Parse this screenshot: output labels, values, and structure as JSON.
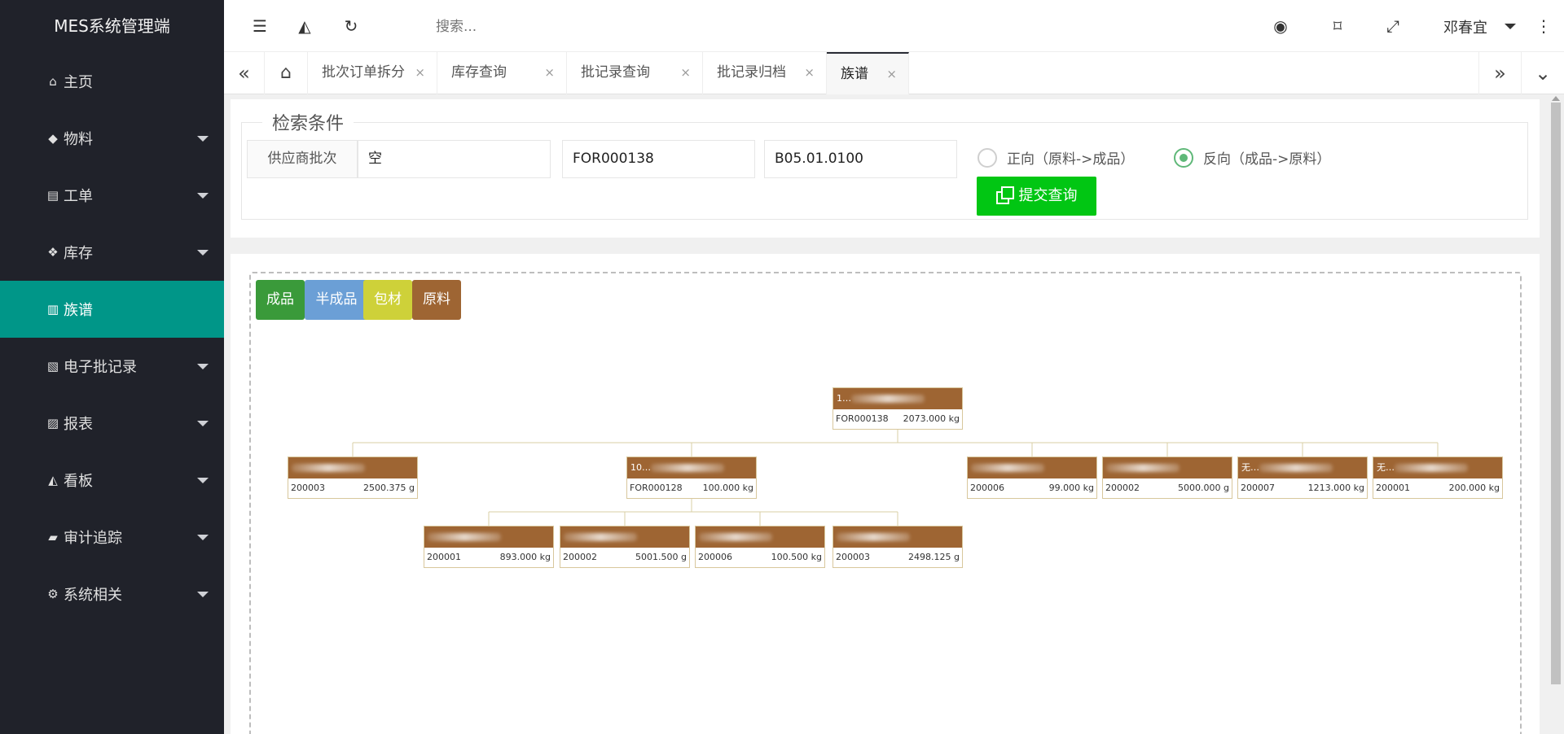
{
  "app": {
    "title": "MES系统管理端"
  },
  "sidebar": {
    "items": [
      {
        "label": "主页",
        "icon": "home-icon",
        "glyph": "⌂",
        "has_caret": false,
        "active": false
      },
      {
        "label": "物料",
        "icon": "cube-icon",
        "glyph": "◆",
        "has_caret": true,
        "active": false
      },
      {
        "label": "工单",
        "icon": "file-text-icon",
        "glyph": "▤",
        "has_caret": true,
        "active": false
      },
      {
        "label": "库存",
        "icon": "cubes-icon",
        "glyph": "❖",
        "has_caret": true,
        "active": false
      },
      {
        "label": "族谱",
        "icon": "file-archive-icon",
        "glyph": "▥",
        "has_caret": false,
        "active": true
      },
      {
        "label": "电子批记录",
        "icon": "file-pdf-icon",
        "glyph": "▧",
        "has_caret": true,
        "active": false
      },
      {
        "label": "报表",
        "icon": "file-excel-icon",
        "glyph": "▨",
        "has_caret": true,
        "active": false
      },
      {
        "label": "看板",
        "icon": "area-chart-icon",
        "glyph": "◭",
        "has_caret": true,
        "active": false
      },
      {
        "label": "审计追踪",
        "icon": "book-icon",
        "glyph": "▰",
        "has_caret": true,
        "active": false
      },
      {
        "label": "系统相关",
        "icon": "cogs-icon",
        "glyph": "⚙",
        "has_caret": true,
        "active": false
      }
    ]
  },
  "header": {
    "search_placeholder": "搜索...",
    "user_name": "邓春宜",
    "icons": {
      "menu_toggle": "☰",
      "chart": "◭",
      "refresh": "↻",
      "theme": "◉",
      "tag": "⌑",
      "fullscreen": "⤢",
      "more": "⋮"
    }
  },
  "tabs": {
    "nav_left": "«",
    "nav_right": "»",
    "dropdown": "⌄",
    "home": "⌂",
    "items": [
      {
        "label": "批次订单拆分",
        "close": "×"
      },
      {
        "label": "库存查询",
        "close": "×"
      },
      {
        "label": "批记录查询",
        "close": "×"
      },
      {
        "label": "批记录归档",
        "close": "×"
      },
      {
        "label": "族谱",
        "close": "×"
      }
    ]
  },
  "search_panel": {
    "legend": "检索条件",
    "supplier_batch_label": "供应商批次",
    "supplier_batch_value": "空",
    "material_code_value": "FOR000138",
    "batch_no_value": "B05.01.0100",
    "radio_forward": "正向（原料->成品）",
    "radio_reverse": "反向（成品->原料）",
    "selected": "reverse",
    "submit_label": "提交查询"
  },
  "legend_types": [
    {
      "label": "成品",
      "color": "#3a9a3a"
    },
    {
      "label": "半成品",
      "color": "#6b9fd6"
    },
    {
      "label": "包材",
      "color": "#ced139"
    },
    {
      "label": "原料",
      "color": "#9e6533"
    }
  ],
  "tree": {
    "root": {
      "name": "1…",
      "code": "FOR000138",
      "qty": "2073.000 kg"
    },
    "level1": [
      {
        "name": "",
        "code": "200003",
        "qty": "2500.375 g"
      },
      {
        "name": "10…",
        "code": "FOR000128",
        "qty": "100.000 kg"
      },
      {
        "name": "",
        "code": "200006",
        "qty": "99.000 kg"
      },
      {
        "name": "",
        "code": "200002",
        "qty": "5000.000 g"
      },
      {
        "name": "无…",
        "code": "200007",
        "qty": "1213.000 kg"
      },
      {
        "name": "无…",
        "code": "200001",
        "qty": "200.000 kg"
      }
    ],
    "level2": [
      {
        "name": "",
        "code": "200001",
        "qty": "893.000 kg"
      },
      {
        "name": "",
        "code": "200002",
        "qty": "5001.500 g"
      },
      {
        "name": "",
        "code": "200006",
        "qty": "100.500 kg"
      },
      {
        "name": "",
        "code": "200003",
        "qty": "2498.125 g"
      }
    ]
  }
}
